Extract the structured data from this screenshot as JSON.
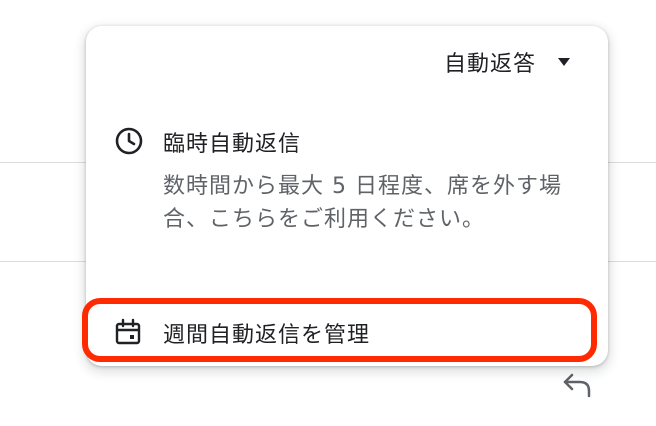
{
  "menu": {
    "header_label": "自動返答",
    "options": [
      {
        "title": "臨時自動返信",
        "description": "数時間から最大 5 日程度、席を外す場合、こちらをご利用ください。",
        "icon": "clock-icon"
      },
      {
        "title": "週間自動返信を管理",
        "icon": "calendar-icon"
      }
    ]
  },
  "colors": {
    "highlight": "#ff2a00",
    "text_primary": "#202124",
    "text_secondary": "#5f6368",
    "divider": "#dadce0"
  },
  "icons": {
    "background_action": "reply-icon",
    "header_caret": "dropdown-caret-icon"
  }
}
